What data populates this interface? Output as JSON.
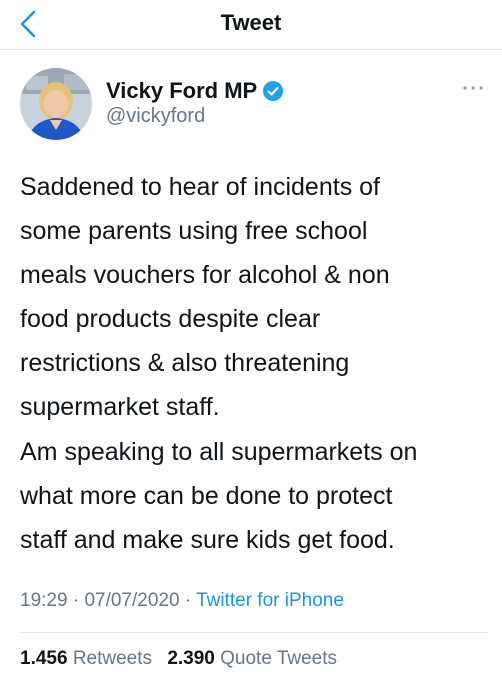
{
  "nav": {
    "title": "Tweet"
  },
  "user": {
    "name": "Vicky Ford MP",
    "handle": "@vickyford",
    "verified": true
  },
  "tweet": {
    "lines_p1": [
      "Saddened to hear of incidents of",
      "some parents using free school",
      "meals vouchers for alcohol & non",
      "food products despite clear",
      "restrictions & also threatening",
      "supermarket staff."
    ],
    "lines_p2": [
      "Am speaking to all supermarkets on",
      "what more can be done to protect",
      "staff and make sure kids get food."
    ]
  },
  "meta": {
    "time": "19:29",
    "sep1": "·",
    "date": "07/07/2020",
    "sep2": "·",
    "source": "Twitter for iPhone"
  },
  "stats": {
    "retweets_count": "1.456",
    "retweets_label": "Retweets",
    "quotes_count": "2.390",
    "quotes_label": "Quote Tweets"
  },
  "colors": {
    "accent": "#1b95e0",
    "secondary_text": "#687684",
    "primary_text": "#0f1419",
    "divider": "#e1e8ed"
  }
}
